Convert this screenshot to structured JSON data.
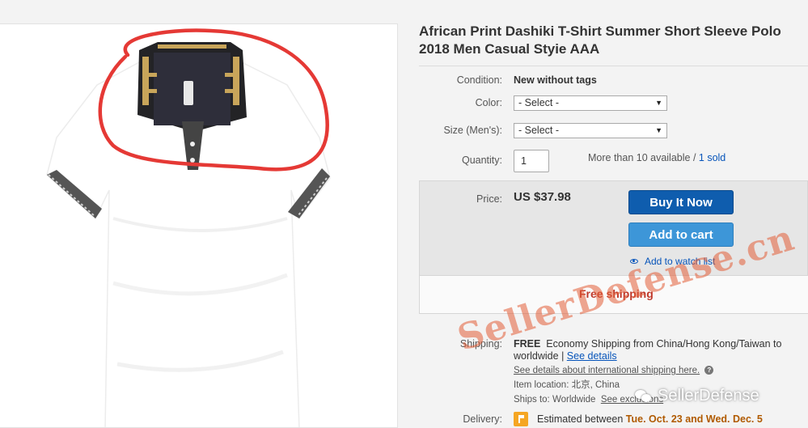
{
  "listing": {
    "title": "African Print Dashiki T-Shirt Summer Short Sleeve Polo 2018 Men Casual Styie AAA"
  },
  "condition": {
    "label": "Condition:",
    "value": "New without tags"
  },
  "color": {
    "label": "Color:",
    "selected": "- Select -"
  },
  "size": {
    "label": "Size (Men's):",
    "selected": "- Select -"
  },
  "quantity": {
    "label": "Quantity:",
    "value": "1",
    "availability": "More than 10 available / ",
    "sold": "1 sold"
  },
  "price": {
    "label": "Price:",
    "value": "US $37.98"
  },
  "actions": {
    "buy_now": "Buy It Now",
    "add_to_cart": "Add to cart",
    "watch": "Add to watch list"
  },
  "shipping_banner": "Free shipping",
  "shipping": {
    "label": "Shipping:",
    "free": "FREE",
    "method_line1": "Economy Shipping from China/Hong Kong/Taiwan to",
    "method_line2": "worldwide",
    "see_details": "See details",
    "intl_details": "See details about international shipping here.",
    "item_location": "Item location: 北京, China",
    "ships_to_label": "Ships to:",
    "ships_to_value": "Worldwide",
    "see_exclusions": "See exclusions"
  },
  "delivery": {
    "label": "Delivery:",
    "text": "Estimated between ",
    "dates": "Tue. Oct. 23 and Wed. Dec. 5"
  },
  "watermarks": {
    "seller": "SellerDefense.cn",
    "wechat": "SellerDefense"
  },
  "colors": {
    "buy_button": "#0f5dae",
    "cart_button": "#3d96d8",
    "link": "#0654ba",
    "free_shipping": "#c0392b",
    "annotation_circle": "#e53935"
  },
  "icons": [
    "eye-icon",
    "chevron-down-icon",
    "help-icon",
    "flag-icon",
    "wechat-icon"
  ]
}
